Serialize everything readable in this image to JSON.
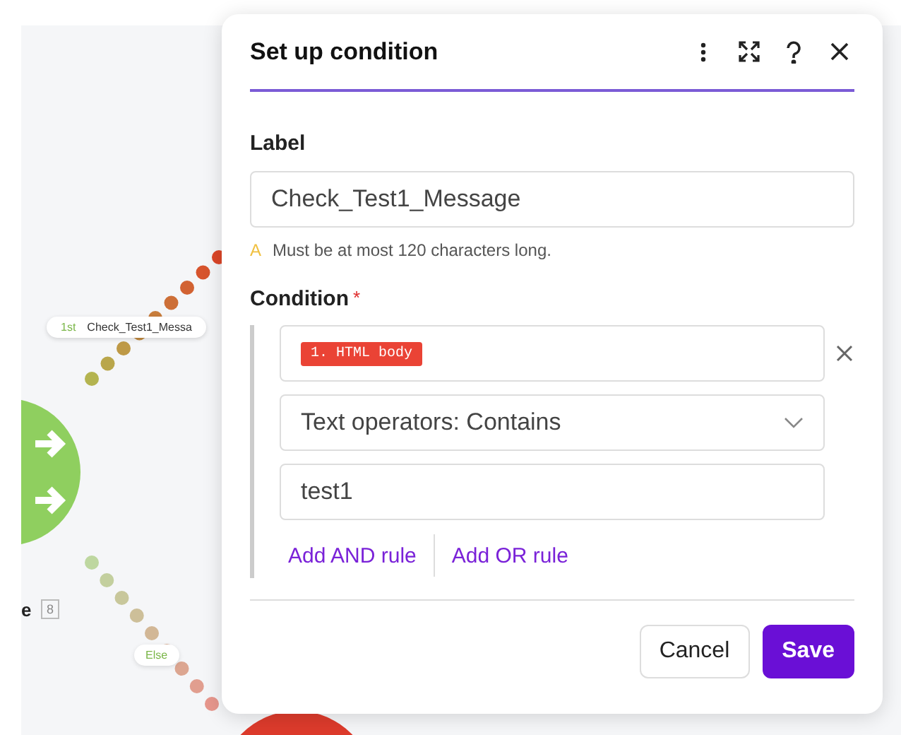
{
  "canvas": {
    "route_label": {
      "order": "1st",
      "text": "Check_Test1_Messa"
    },
    "node_name": "e",
    "node_badge": "8",
    "else_label": "Else"
  },
  "dialog": {
    "title": "Set up condition",
    "label_field": {
      "label": "Label",
      "value": "Check_Test1_Message",
      "warning_icon": "A",
      "warning": "Must be at most 120 characters long."
    },
    "condition": {
      "label": "Condition",
      "required_mark": "*",
      "rule": {
        "item_token": "1. HTML body",
        "operator": "Text operators: Contains",
        "value": "test1"
      },
      "actions": [
        "Add AND rule",
        "Add OR rule"
      ]
    },
    "buttons": [
      {
        "label": "Cancel",
        "kind": "secondary"
      },
      {
        "label": "Save",
        "kind": "primary"
      }
    ]
  }
}
